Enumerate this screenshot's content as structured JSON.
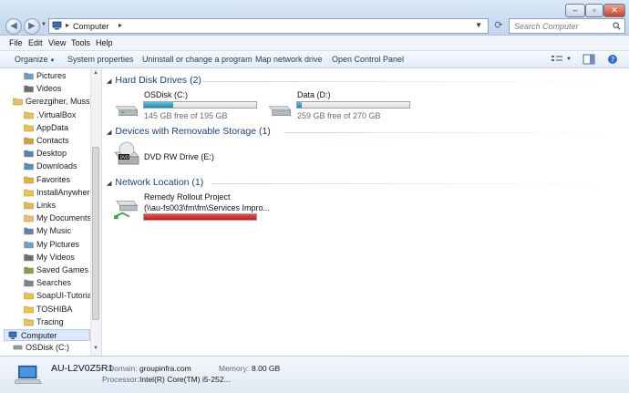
{
  "window": {
    "address_root": "Computer",
    "search_placeholder": "Search Computer"
  },
  "menu": [
    "File",
    "Edit",
    "View",
    "Tools",
    "Help"
  ],
  "toolbar": {
    "organize": "Organize",
    "system_properties": "System properties",
    "uninstall": "Uninstall or change a program",
    "map_network_drive": "Map network drive",
    "open_control_panel": "Open Control Panel"
  },
  "nav": [
    {
      "label": "Pictures",
      "icon": "pictures-icon",
      "indent": 2
    },
    {
      "label": "Videos",
      "icon": "videos-icon",
      "indent": 2
    },
    {
      "label": "Gerezgiher, Mussie",
      "icon": "user-folder-icon",
      "indent": 1
    },
    {
      "label": ".VirtualBox",
      "icon": "folder-icon",
      "indent": 2
    },
    {
      "label": "AppData",
      "icon": "folder-icon",
      "indent": 2
    },
    {
      "label": "Contacts",
      "icon": "contacts-icon",
      "indent": 2
    },
    {
      "label": "Desktop",
      "icon": "desktop-icon",
      "indent": 2
    },
    {
      "label": "Downloads",
      "icon": "downloads-icon",
      "indent": 2
    },
    {
      "label": "Favorites",
      "icon": "favorites-icon",
      "indent": 2
    },
    {
      "label": "InstallAnywhere",
      "icon": "folder-icon",
      "indent": 2
    },
    {
      "label": "Links",
      "icon": "links-icon",
      "indent": 2
    },
    {
      "label": "My Documents",
      "icon": "documents-icon",
      "indent": 2
    },
    {
      "label": "My Music",
      "icon": "music-icon",
      "indent": 2
    },
    {
      "label": "My Pictures",
      "icon": "pictures-icon",
      "indent": 2
    },
    {
      "label": "My Videos",
      "icon": "videos-icon",
      "indent": 2
    },
    {
      "label": "Saved Games",
      "icon": "saved-games-icon",
      "indent": 2
    },
    {
      "label": "Searches",
      "icon": "searches-icon",
      "indent": 2
    },
    {
      "label": "SoapUI-Tutorials",
      "icon": "folder-icon",
      "indent": 2
    },
    {
      "label": "TOSHIBA",
      "icon": "folder-icon",
      "indent": 2
    },
    {
      "label": "Tracing",
      "icon": "folder-icon",
      "indent": 2
    },
    {
      "label": "Computer",
      "icon": "computer-icon",
      "indent": 0,
      "selected": true
    },
    {
      "label": "OSDisk (C:)",
      "icon": "drive-icon",
      "indent": 1
    }
  ],
  "groups": {
    "hard_disk": "Hard Disk Drives (2)",
    "removable": "Devices with Removable Storage (1)",
    "network": "Network Location (1)"
  },
  "drives": {
    "c": {
      "name": "OSDisk (C:)",
      "free": "145 GB free of 195 GB",
      "used_fraction": 0.26
    },
    "d": {
      "name": "Data (D:)",
      "free": "259 GB free of 270 GB",
      "used_fraction": 0.04
    },
    "dvd": {
      "name": "DVD RW Drive (E:)"
    },
    "net": {
      "name": "Remedy Rollout Project",
      "path": "(\\\\au-fs003\\fm\\fm\\Services Impro...",
      "used_fraction": 1.0
    }
  },
  "details": {
    "computer_name": "AU-L2V0Z5R1",
    "domain_label": "Domain:",
    "domain_value": "groupinfra.com",
    "memory_label": "Memory:",
    "memory_value": "8.00 GB",
    "processor_label": "Processor:",
    "processor_value": "Intel(R) Core(TM) i5-252..."
  },
  "colors": {
    "accent": "#1e3f79",
    "bar_fill": "#26a0da",
    "bar_full": "#d31a1a"
  }
}
